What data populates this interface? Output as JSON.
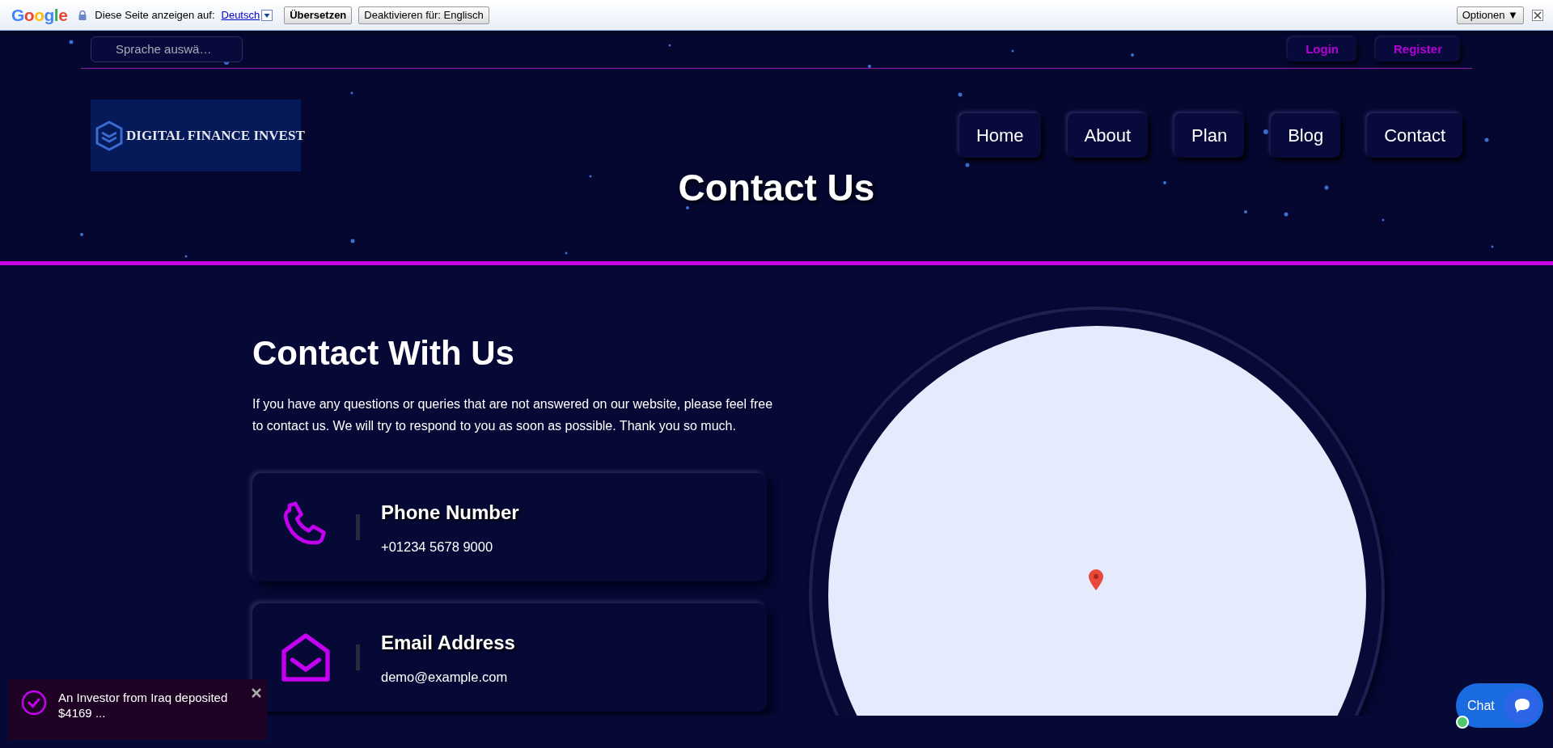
{
  "translate_bar": {
    "logo": "Google",
    "label": "Diese Seite anzeigen auf:",
    "language_link": "Deutsch",
    "buttons": [
      "Übersetzen",
      "Deaktivieren für: Englisch"
    ],
    "options_button": "Optionen ▼"
  },
  "top_bar": {
    "language_select": "Sprache auswä…",
    "buttons": [
      "Login",
      "Register"
    ]
  },
  "header": {
    "logo_text": "DIGITAL FINANCE INVEST",
    "nav": [
      {
        "label": "Home"
      },
      {
        "label": "About"
      },
      {
        "label": "Plan"
      },
      {
        "label": "Blog"
      },
      {
        "label": "Contact"
      }
    ],
    "page_title": "Contact Us"
  },
  "contact": {
    "heading": "Contact With Us",
    "intro": "If you have any questions or queries that are not answered on our website, please feel free to contact us. We will try to respond to you as soon as possible. Thank you so much.",
    "cards": [
      {
        "kind": "phone",
        "title": "Phone Number",
        "value": "+01234 5678 9000"
      },
      {
        "kind": "email",
        "title": "Email Address",
        "value": "demo@example.com"
      }
    ]
  },
  "toast": {
    "message": "An Investor from Iraq deposited $4169 ..."
  },
  "chat": {
    "label": "Chat",
    "online": true
  }
}
